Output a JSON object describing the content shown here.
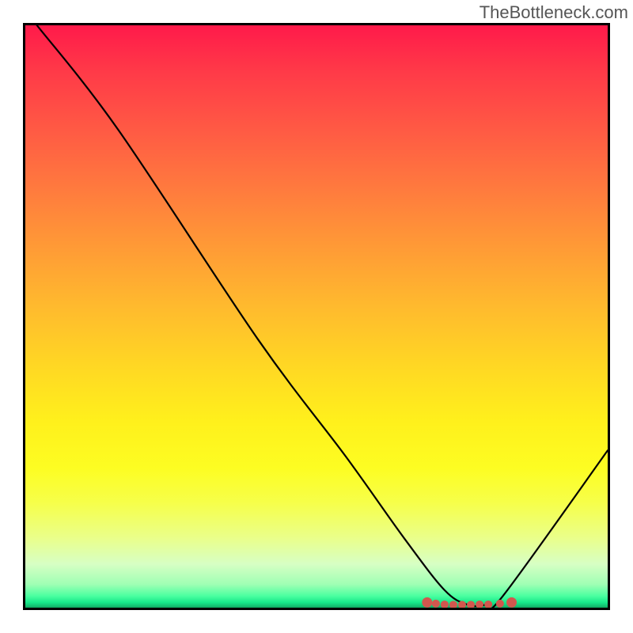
{
  "watermark": "TheBottleneck.com",
  "chart_data": {
    "type": "line",
    "title": "",
    "xlabel": "",
    "ylabel": "",
    "xlim": [
      0,
      100
    ],
    "ylim": [
      0,
      100
    ],
    "grid": false,
    "series": [
      {
        "name": "curve",
        "x": [
          2,
          16,
          40,
          55,
          65,
          72,
          76,
          79,
          82,
          100
        ],
        "y": [
          100,
          82,
          46,
          26,
          12,
          3,
          0.5,
          0.5,
          2,
          27
        ]
      }
    ],
    "annotations": {
      "optimum_dots": {
        "color": "#d1574e",
        "points": [
          {
            "x": 69.0,
            "y": 0.9
          },
          {
            "x": 70.5,
            "y": 0.7
          },
          {
            "x": 72.0,
            "y": 0.55
          },
          {
            "x": 73.5,
            "y": 0.5
          },
          {
            "x": 75.0,
            "y": 0.5
          },
          {
            "x": 76.5,
            "y": 0.5
          },
          {
            "x": 78.0,
            "y": 0.55
          },
          {
            "x": 79.5,
            "y": 0.55
          },
          {
            "x": 81.5,
            "y": 0.7
          },
          {
            "x": 83.5,
            "y": 0.9
          }
        ]
      }
    },
    "background_gradient": [
      "#ff1a4a",
      "#ff5a44",
      "#ff9a36",
      "#ffd624",
      "#fdfd22",
      "#d7ffc4",
      "#4affa0",
      "#11a862"
    ]
  }
}
